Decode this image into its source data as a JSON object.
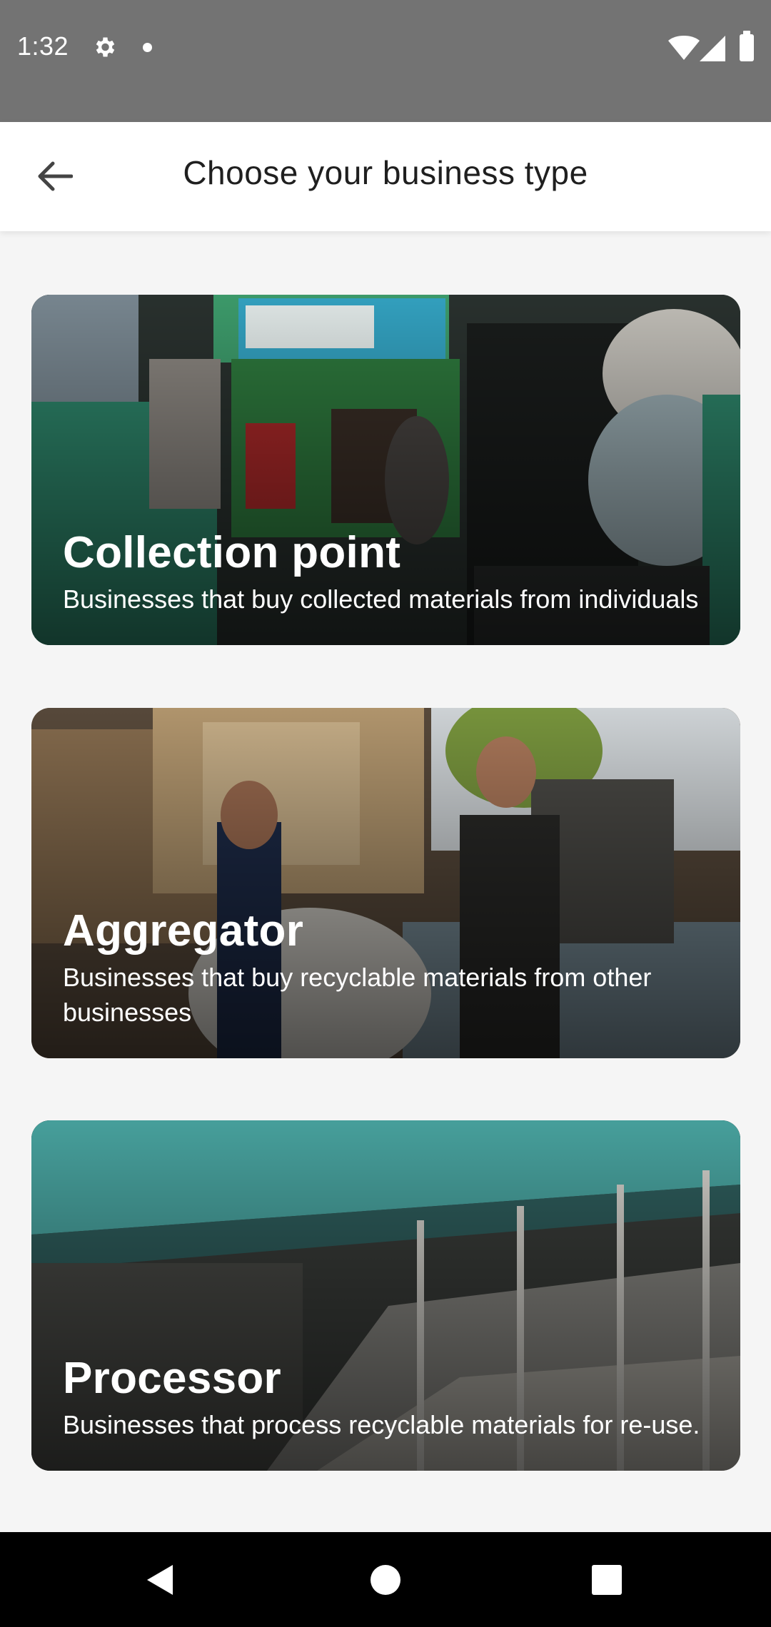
{
  "status_bar": {
    "time": "1:32",
    "icons": [
      "gear-icon",
      "notification-dot-icon",
      "wifi-icon",
      "signal-icon",
      "battery-icon"
    ]
  },
  "app_bar": {
    "back_icon": "arrow-left-icon",
    "title": "Choose your business type"
  },
  "business_types": [
    {
      "title": "Collection point",
      "description": "Businesses that buy collected materials from individuals"
    },
    {
      "title": "Aggregator",
      "description": "Businesses that buy recyclable materials from other businesses"
    },
    {
      "title": "Processor",
      "description": "Businesses that process recyclable materials for re-use."
    }
  ],
  "nav_bar": {
    "icons": [
      "nav-back-icon",
      "nav-home-icon",
      "nav-recents-icon"
    ]
  },
  "colors": {
    "status_bar": "#737373",
    "app_bar": "#ffffff",
    "background": "#f5f5f5",
    "nav_bar": "#000000",
    "title_text": "#1f1f1f"
  }
}
